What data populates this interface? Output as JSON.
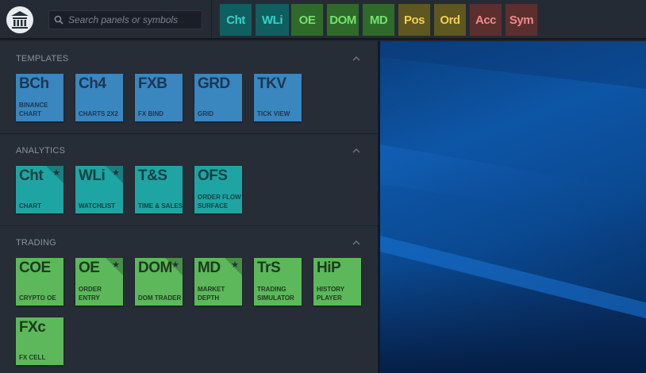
{
  "search": {
    "placeholder": "Search panels or symbols"
  },
  "quick_buttons": [
    {
      "label": "Cht",
      "bg": "#0f5f60",
      "color": "#35d3c6"
    },
    {
      "label": "WLi",
      "bg": "#0f5f60",
      "color": "#35d3c6"
    },
    {
      "label": "OE",
      "bg": "#2f6a2b",
      "color": "#74e06b"
    },
    {
      "label": "DOM",
      "bg": "#2f6a2b",
      "color": "#74e06b"
    },
    {
      "label": "MD",
      "bg": "#2f6a2b",
      "color": "#74e06b"
    },
    {
      "label": "Pos",
      "bg": "#5e5720",
      "color": "#f1cf4c"
    },
    {
      "label": "Ord",
      "bg": "#5e5720",
      "color": "#f1cf4c"
    },
    {
      "label": "Acc",
      "bg": "#5c2f2f",
      "color": "#ee8a8a"
    },
    {
      "label": "Sym",
      "bg": "#5c2f2f",
      "color": "#ee8a8a"
    }
  ],
  "sections": [
    {
      "title": "TEMPLATES",
      "tiles": [
        {
          "abbr": "BCh",
          "name": "BINANCE CHART",
          "starred": false
        },
        {
          "abbr": "Ch4",
          "name": "CHARTS 2X2",
          "starred": false
        },
        {
          "abbr": "FXB",
          "name": "FX BIND",
          "starred": false
        },
        {
          "abbr": "GRD",
          "name": "GRID",
          "starred": false
        },
        {
          "abbr": "TKV",
          "name": "TICK VIEW",
          "starred": false
        }
      ]
    },
    {
      "title": "ANALYTICS",
      "tiles": [
        {
          "abbr": "Cht",
          "name": "CHART",
          "starred": true
        },
        {
          "abbr": "WLi",
          "name": "WATCHLIST",
          "starred": true
        },
        {
          "abbr": "T&S",
          "name": "TIME & SALES",
          "starred": false
        },
        {
          "abbr": "OFS",
          "name": "ORDER FLOW SURFACE",
          "starred": false
        }
      ]
    },
    {
      "title": "TRADING",
      "tiles": [
        {
          "abbr": "COE",
          "name": "CRYPTO OE",
          "starred": false
        },
        {
          "abbr": "OE",
          "name": "ORDER ENTRY",
          "starred": true
        },
        {
          "abbr": "DOM",
          "name": "DOM TRADER",
          "starred": true
        },
        {
          "abbr": "MD",
          "name": "MARKET DEPTH",
          "starred": true
        },
        {
          "abbr": "TrS",
          "name": "TRADING SIMULATOR",
          "starred": false
        },
        {
          "abbr": "HiP",
          "name": "HISTORY PLAYER",
          "starred": false
        },
        {
          "abbr": "FXc",
          "name": "FX CELL",
          "starred": false
        }
      ]
    }
  ],
  "colors": {
    "templates": "#3a86bf",
    "analytics": "#1ea5a3",
    "trading": "#5cb85a"
  }
}
